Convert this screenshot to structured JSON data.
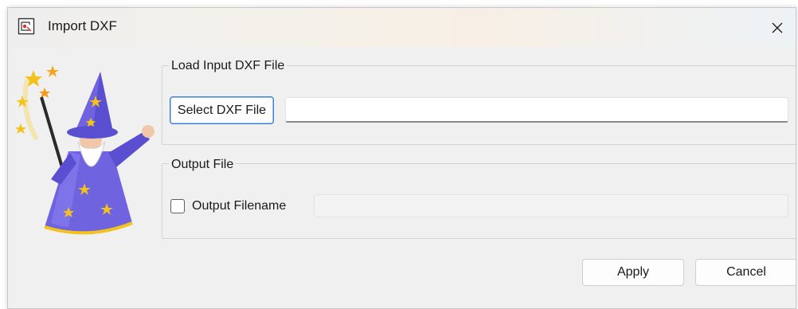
{
  "window": {
    "title": "Import DXF",
    "app_icon": "dxf-document-icon",
    "close_icon": "close-icon"
  },
  "illustration": {
    "icon": "wizard-icon"
  },
  "load_group": {
    "title": "Load Input DXF File",
    "select_label": "Select DXF File",
    "file_value": "",
    "file_placeholder": ""
  },
  "output_group": {
    "title": "Output File",
    "checkbox_label": "Output Filename",
    "checkbox_checked": false,
    "filename_value": "",
    "filename_placeholder": ""
  },
  "footer": {
    "apply_label": "Apply",
    "cancel_label": "Cancel"
  },
  "colors": {
    "dialog_bg": "#f0f0f0",
    "accent_border": "#3a7cd1",
    "robe": "#6f63e0",
    "star": "#f3c21c"
  }
}
